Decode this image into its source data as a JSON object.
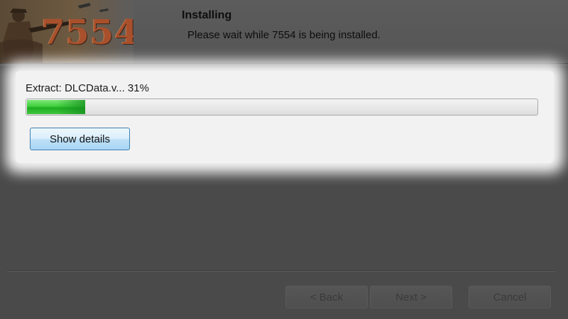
{
  "header": {
    "banner_text": "7554",
    "title": "Installing",
    "subtitle": "Please wait while 7554 is being installed."
  },
  "progress": {
    "status_text": "Extract: DLCData.v... 31%",
    "percent": 31,
    "fill_color": "#3fcf3c",
    "show_details_label": "Show details"
  },
  "footer": {
    "back_label": "< Back",
    "next_label": "Next >",
    "cancel_label": "Cancel"
  }
}
